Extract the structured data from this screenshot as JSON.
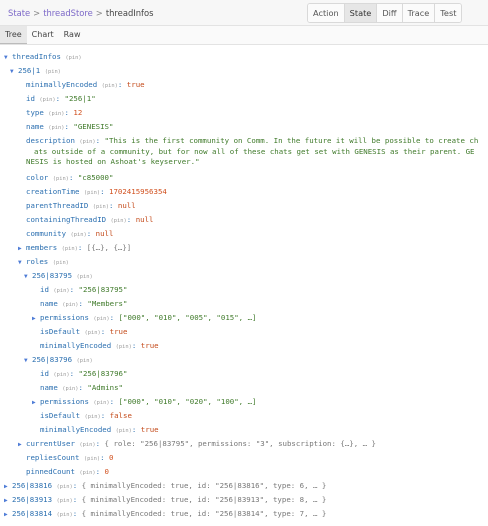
{
  "breadcrumb": {
    "items": [
      "State",
      "threadStore",
      "threadInfos"
    ],
    "separator": ">"
  },
  "modes": [
    "Action",
    "State",
    "Diff",
    "Trace",
    "Test"
  ],
  "active_mode": "State",
  "tabs": [
    "Tree",
    "Chart",
    "Raw"
  ],
  "active_tab": "Tree",
  "pin_label": "(pin)",
  "tree": {
    "root_key": "threadInfos",
    "thread": {
      "key": "256|1",
      "minimallyEncoded": "true",
      "id": "\"256|1\"",
      "type": "12",
      "name": "\"GENESIS\"",
      "description_lines": [
        "\"This is the first community on Comm. In the future it will be possible to create ch",
        "ats outside of a community, but for now all of these chats get set with GENESIS as their parent. GE",
        "NESIS is hosted on Ashoat's keyserver.\""
      ],
      "color": "\"c85000\"",
      "creationTime": "1702415956354",
      "parentThreadID": "null",
      "containingThreadID": "null",
      "community": "null",
      "members_preview": "[{…}, {…}]",
      "roles": [
        {
          "key": "256|83795",
          "id": "\"256|83795\"",
          "name": "\"Members\"",
          "permissions_preview": "[\"000\", \"010\", \"005\", \"015\", …]",
          "isDefault": "true",
          "minimallyEncoded": "true"
        },
        {
          "key": "256|83796",
          "id": "\"256|83796\"",
          "name": "\"Admins\"",
          "permissions_preview": "[\"000\", \"010\", \"020\", \"100\", …]",
          "isDefault": "false",
          "minimallyEncoded": "true"
        }
      ],
      "currentUser_preview": "{ role: \"256|83795\", permissions: \"3\", subscription: {…}, … }",
      "repliesCount": "0",
      "pinnedCount": "0"
    },
    "collapsed_threads": [
      {
        "key": "256|83816",
        "preview": "{ minimallyEncoded: true, id: \"256|83816\", type: 6, … }"
      },
      {
        "key": "256|83913",
        "preview": "{ minimallyEncoded: true, id: \"256|83913\", type: 8, … }"
      },
      {
        "key": "256|83814",
        "preview": "{ minimallyEncoded: true, id: \"256|83814\", type: 7, … }"
      }
    ],
    "keys": {
      "minimallyEncoded": "minimallyEncoded",
      "id": "id",
      "type": "type",
      "name": "name",
      "description": "description",
      "color": "color",
      "creationTime": "creationTime",
      "parentThreadID": "parentThreadID",
      "containingThreadID": "containingThreadID",
      "community": "community",
      "members": "members",
      "roles": "roles",
      "permissions": "permissions",
      "isDefault": "isDefault",
      "currentUser": "currentUser",
      "repliesCount": "repliesCount",
      "pinnedCount": "pinnedCount"
    }
  }
}
